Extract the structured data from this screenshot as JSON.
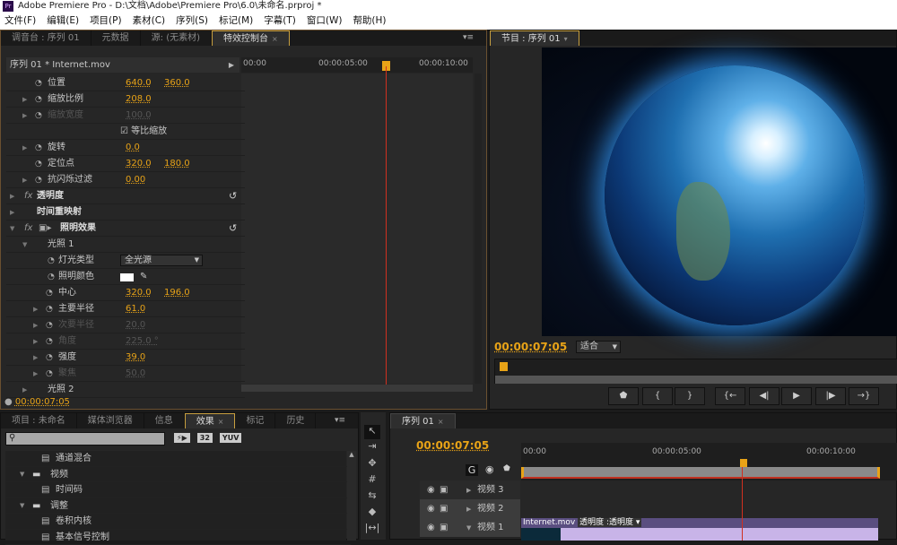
{
  "app": {
    "title": "Adobe Premiere Pro - D:\\文档\\Adobe\\Premiere Pro\\6.0\\未命名.prproj *",
    "logo": "Pr"
  },
  "menu": [
    "文件(F)",
    "编辑(E)",
    "项目(P)",
    "素材(C)",
    "序列(S)",
    "标记(M)",
    "字幕(T)",
    "窗口(W)",
    "帮助(H)"
  ],
  "source_panel": {
    "tabs": [
      "调音台 : 序列 01",
      "元数据",
      "源: (无素材)",
      "特效控制台"
    ],
    "active_tab": 3,
    "clip_header": "序列 01 * Internet.mov",
    "ruler": [
      "00:00",
      "00:00:05:00",
      "00:00:10:00"
    ],
    "rows": [
      {
        "label": "位置",
        "v1": "640.0",
        "v2": "360.0",
        "tri": false,
        "dim": false
      },
      {
        "label": "缩放比例",
        "v1": "208.0",
        "tri": true,
        "dim": false
      },
      {
        "label": "缩放宽度",
        "v1": "100.0",
        "tri": true,
        "dim": true
      },
      {
        "check": "等比缩放"
      },
      {
        "label": "旋转",
        "v1": "0.0",
        "tri": true
      },
      {
        "label": "定位点",
        "v1": "320.0",
        "v2": "180.0"
      },
      {
        "label": "抗闪烁过滤",
        "v1": "0.00",
        "tri": true
      }
    ],
    "sections": [
      "透明度",
      "时间重映射",
      "照明效果"
    ],
    "light": {
      "group": "光照 1",
      "type_label": "灯光类型",
      "type_value": "全光源",
      "color_label": "照明颜色",
      "light_color": "#ffffff",
      "rows": [
        {
          "label": "中心",
          "v1": "320.0",
          "v2": "196.0",
          "tri": false,
          "dim": false
        },
        {
          "label": "主要半径",
          "v1": "61.0",
          "tri": true,
          "dim": false
        },
        {
          "label": "次要半径",
          "v1": "20.0",
          "tri": true,
          "dim": true
        },
        {
          "label": "角度",
          "v1": "225.0 °",
          "tri": true,
          "dim": true
        },
        {
          "label": "强度",
          "v1": "39.0",
          "tri": true,
          "dim": false
        },
        {
          "label": "聚焦",
          "v1": "50.0",
          "tri": true,
          "dim": true
        }
      ],
      "group2": "光照 2"
    },
    "timecode": "00:00:07:05"
  },
  "program": {
    "tab": "节目 : 序列 01",
    "timecode": "00:00:07:05",
    "zoom": "适合",
    "buttons": [
      "marker",
      "{",
      "}",
      "{←",
      "◀|",
      "▶",
      "|▶",
      "→}"
    ]
  },
  "project_panel": {
    "tabs": [
      "项目 : 未命名",
      "媒体浏览器",
      "信息",
      "效果",
      "标记",
      "历史"
    ],
    "active_tab": 3,
    "search_placeholder": "",
    "badges": [
      "⚡▶",
      "32",
      "YUV"
    ],
    "items": [
      {
        "label": "通道混合",
        "type": "effect",
        "indent": 2
      },
      {
        "label": "视频",
        "type": "folder",
        "indent": 1
      },
      {
        "label": "时间码",
        "type": "effect",
        "indent": 2
      },
      {
        "label": "调整",
        "type": "folder",
        "indent": 1
      },
      {
        "label": "卷积内核",
        "type": "effect",
        "indent": 2
      },
      {
        "label": "基本信号控制",
        "type": "effect",
        "indent": 2
      }
    ]
  },
  "timeline": {
    "tab": "序列 01",
    "timecode": "00:00:07:05",
    "ruler": [
      "00:00",
      "00:00:05:00",
      "00:00:10:00"
    ],
    "tracks": [
      "视频 3",
      "视频 2",
      "视频 1"
    ],
    "clip": "Internet.mov",
    "clip_fx": "透明度 :透明度"
  },
  "colors": {
    "accent": "#e8a317",
    "playhead": "#d03020",
    "clip": "#c8b4e8"
  }
}
